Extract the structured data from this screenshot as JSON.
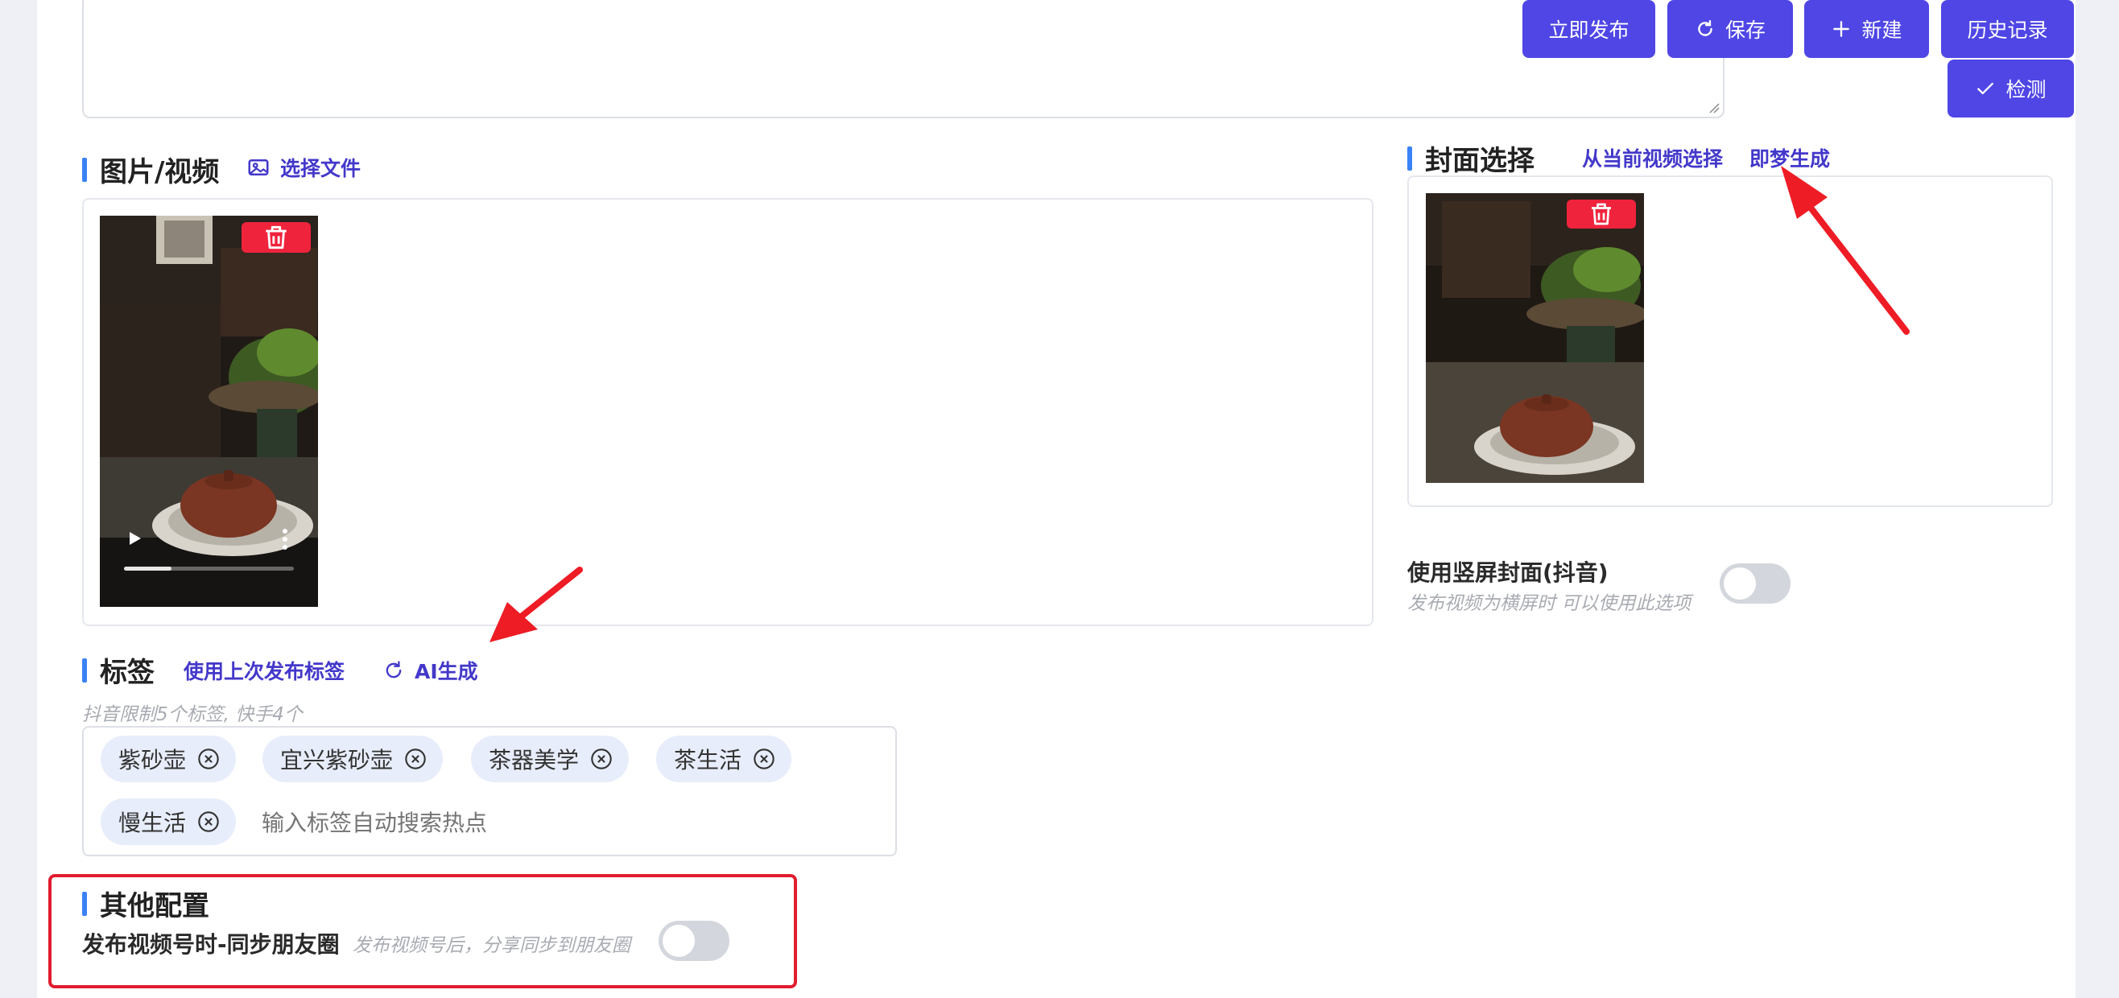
{
  "toolbar": {
    "publish_label": "立即发布",
    "save_label": "保存",
    "new_label": "新建",
    "history_label": "历史记录",
    "detect_label": "检测"
  },
  "media": {
    "title": "图片/视频",
    "select_file_label": "选择文件"
  },
  "cover": {
    "title": "封面选择",
    "from_video_label": "从当前视频选择",
    "jimeng_label": "即梦生成",
    "vertical_cover_label": "使用竖屏封面(抖音)",
    "vertical_cover_hint": "发布视频为横屏时 可以使用此选项",
    "vertical_cover_enabled": false
  },
  "tags": {
    "title": "标签",
    "use_last_label": "使用上次发布标签",
    "ai_label": "AI生成",
    "limit_hint": "抖音限制5个标签, 快手4个",
    "items": [
      "紫砂壶",
      "宜兴紫砂壶",
      "茶器美学",
      "茶生活",
      "慢生活"
    ],
    "input_placeholder": "输入标签自动搜索热点"
  },
  "other": {
    "title": "其他配置",
    "sync_label": "发布视频号时-同步朋友圈",
    "sync_hint": "发布视频号后，分享同步到朋友圈",
    "sync_enabled": false
  },
  "colors": {
    "primary": "#4f46e5",
    "link": "#4338ca",
    "danger": "#ef233c",
    "annotation": "#e11d2e"
  }
}
